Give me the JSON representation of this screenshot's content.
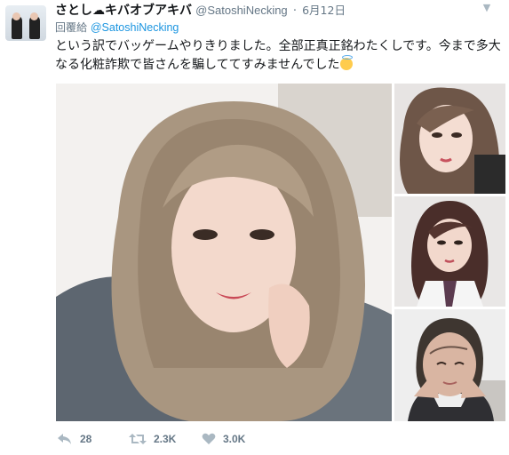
{
  "tweet": {
    "display_name": "さとし☁キバオブアキバ",
    "handle": "@SatoshiNecking",
    "separator": "·",
    "date": "6月12日",
    "reply_label": "回覆給",
    "reply_handle": "@SatoshiNecking",
    "text": "という訳でバッゲームやりきりました。全部正真正銘わたくしです。今まで多大なる化粧詐欺で皆さんを騙しててすみませんでした",
    "emoji": "smiling-face-with-halo-emoji",
    "photos": [
      {
        "name": "main-photo",
        "description_icon": "photo-icon"
      },
      {
        "name": "photo-top",
        "description_icon": "photo-icon"
      },
      {
        "name": "photo-middle",
        "description_icon": "photo-icon"
      },
      {
        "name": "photo-bottom",
        "description_icon": "photo-icon"
      }
    ],
    "actions": {
      "reply_count": "28",
      "retweet_count": "2.3K",
      "like_count": "3.0K"
    },
    "colors": {
      "link": "#1b95e0",
      "secondary_text": "#657786",
      "icon": "#aab8c2"
    }
  }
}
